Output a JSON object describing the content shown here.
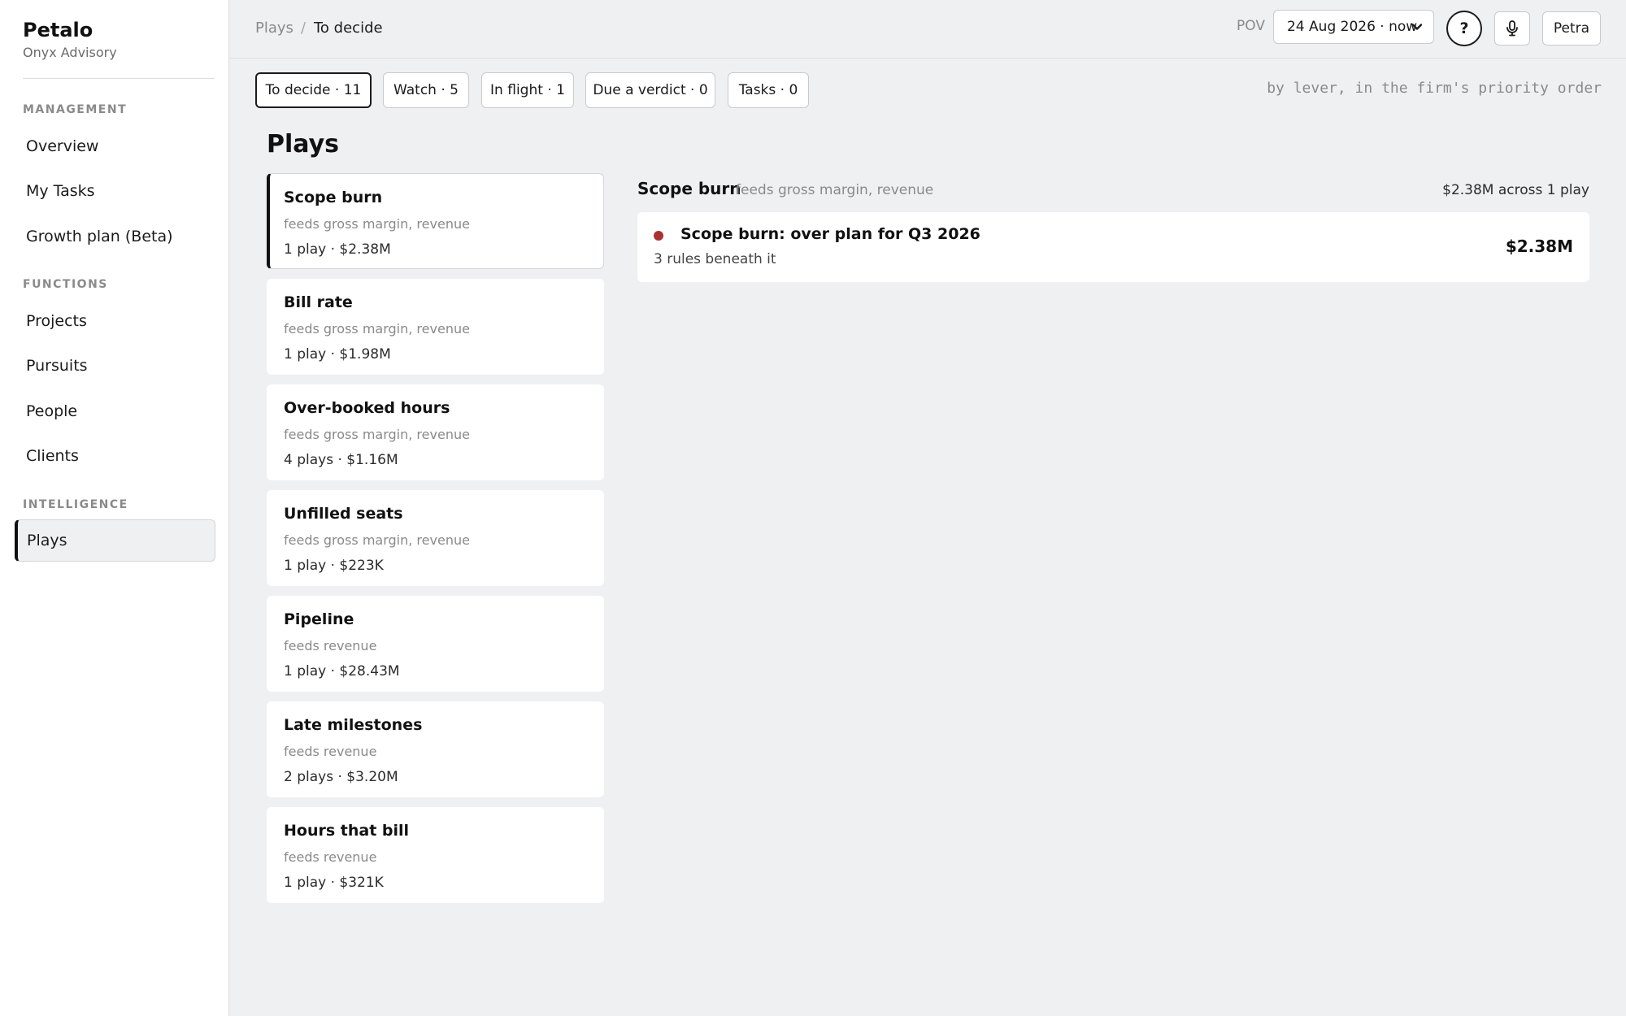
{
  "app": {
    "name": "Petalo",
    "org": "Onyx Advisory"
  },
  "sidebar": {
    "sections": [
      {
        "label": "MANAGEMENT",
        "items": [
          "Overview",
          "My Tasks",
          "Growth plan (Beta)"
        ]
      },
      {
        "label": "FUNCTIONS",
        "items": [
          "Projects",
          "Pursuits",
          "People",
          "Clients"
        ]
      },
      {
        "label": "INTELLIGENCE",
        "items": [
          "Plays"
        ]
      }
    ],
    "active": "Plays"
  },
  "breadcrumb": {
    "root": "Plays",
    "separator": "/",
    "current": "To decide"
  },
  "pov": {
    "label": "POV",
    "value": "24 Aug 2026 · now"
  },
  "header": {
    "help_label": "?",
    "user_label": "Petra",
    "mic_icon": "microphone-icon"
  },
  "tabs": [
    {
      "label": "To decide · 11",
      "active": true
    },
    {
      "label": "Watch · 5",
      "active": false
    },
    {
      "label": "In flight · 1",
      "active": false
    },
    {
      "label": "Due a verdict · 0",
      "active": false
    },
    {
      "label": "Tasks · 0",
      "active": false
    }
  ],
  "priority_note": "by lever, in the firm's priority order",
  "page_title": "Plays",
  "levers": [
    {
      "title": "Scope burn",
      "feeds": "feeds gross margin, revenue",
      "meta": "1 play · $2.38M",
      "active": true
    },
    {
      "title": "Bill rate",
      "feeds": "feeds gross margin, revenue",
      "meta": "1 play · $1.98M"
    },
    {
      "title": "Over-booked hours",
      "feeds": "feeds gross margin, revenue",
      "meta": "4 plays · $1.16M"
    },
    {
      "title": "Unfilled seats",
      "feeds": "feeds gross margin, revenue",
      "meta": "1 play · $223K"
    },
    {
      "title": "Pipeline",
      "feeds": "feeds revenue",
      "meta": "1 play · $28.43M"
    },
    {
      "title": "Late milestones",
      "feeds": "feeds revenue",
      "meta": "2 plays · $3.20M"
    },
    {
      "title": "Hours that bill",
      "feeds": "feeds revenue",
      "meta": "1 play · $321K"
    }
  ],
  "detail": {
    "title": "Scope burn",
    "feeds": "feeds gross margin, revenue",
    "total": "$2.38M across 1 play",
    "plays": [
      {
        "title": "Scope burn: over plan for Q3 2026",
        "sub": "3 rules beneath it",
        "amount": "$2.38M",
        "status_color": "#a83232"
      }
    ]
  }
}
